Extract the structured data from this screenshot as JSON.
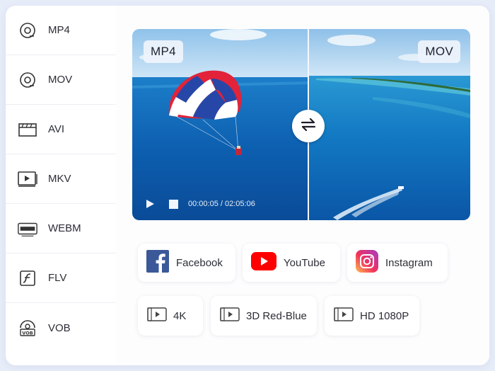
{
  "sidebar": {
    "items": [
      {
        "label": "MP4",
        "icon": "disc-icon"
      },
      {
        "label": "MOV",
        "icon": "disc-icon"
      },
      {
        "label": "AVI",
        "icon": "clapperboard-icon"
      },
      {
        "label": "MKV",
        "icon": "video-screen-icon"
      },
      {
        "label": "WEBM",
        "icon": "webm-icon"
      },
      {
        "label": "FLV",
        "icon": "flash-icon"
      },
      {
        "label": "VOB",
        "icon": "vob-icon"
      }
    ]
  },
  "preview": {
    "left_format": "MP4",
    "right_format": "MOV",
    "time": "00:00:05 / 02:05:06"
  },
  "platforms": [
    {
      "label": "Facebook",
      "color": "#3b5998"
    },
    {
      "label": "YouTube",
      "color": "#ff0000"
    },
    {
      "label": "Instagram",
      "color": "#e1306c"
    }
  ],
  "presets": [
    {
      "label": "4K"
    },
    {
      "label": "3D Red-Blue"
    },
    {
      "label": "HD 1080P"
    }
  ]
}
